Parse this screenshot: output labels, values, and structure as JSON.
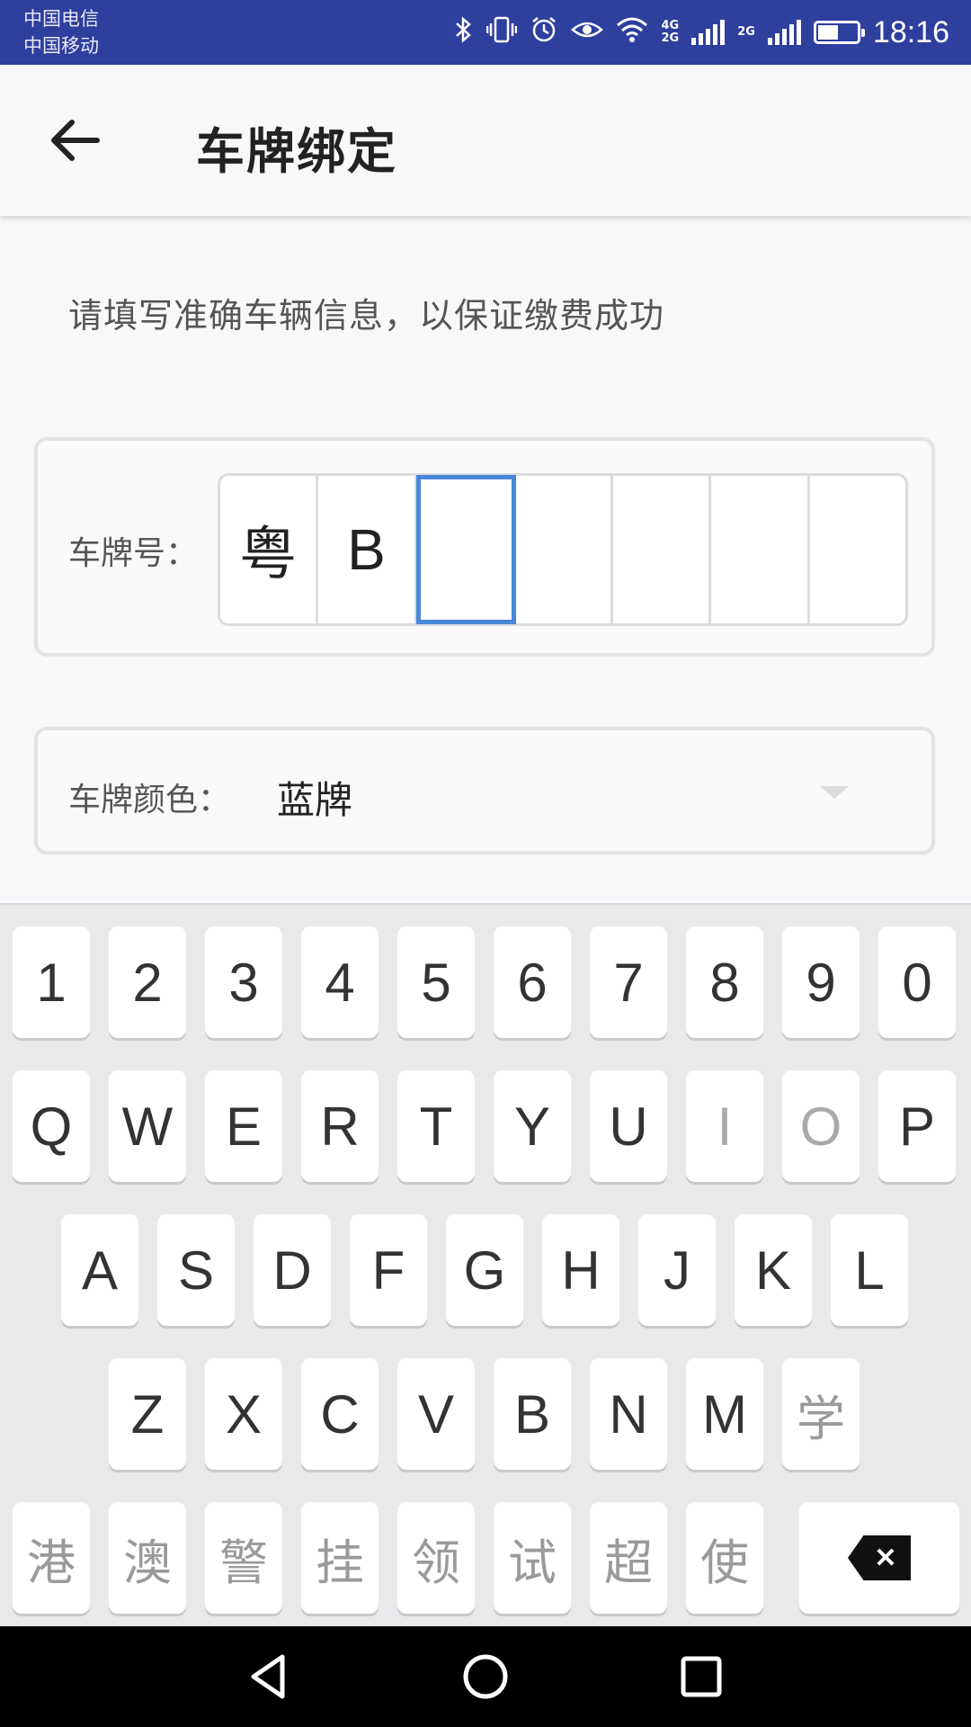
{
  "status": {
    "carrier1": "中国电信",
    "carrier2": "中国移动",
    "net_top": "4G",
    "net_bottom": "2G",
    "net2": "2G",
    "time": "18:16",
    "icons": [
      "bluetooth-icon",
      "vibrate-icon",
      "alarm-icon",
      "eye-icon",
      "wifi-icon",
      "signal-icon",
      "signal-icon",
      "battery-icon"
    ]
  },
  "header": {
    "title": "车牌绑定"
  },
  "hint": "请填写准确车辆信息，以保证缴费成功",
  "plate": {
    "label": "车牌号：",
    "cells": [
      "粤",
      "B",
      "",
      "",
      "",
      "",
      ""
    ],
    "active_index": 2
  },
  "plate_color": {
    "label": "车牌颜色：",
    "value": "蓝牌"
  },
  "keyboard": {
    "row1": [
      "1",
      "2",
      "3",
      "4",
      "5",
      "6",
      "7",
      "8",
      "9",
      "0"
    ],
    "row2": [
      "Q",
      "W",
      "E",
      "R",
      "T",
      "Y",
      "U",
      "I",
      "O",
      "P"
    ],
    "row3": [
      "A",
      "S",
      "D",
      "F",
      "G",
      "H",
      "J",
      "K",
      "L"
    ],
    "row4": [
      "Z",
      "X",
      "C",
      "V",
      "B",
      "N",
      "M",
      "学"
    ],
    "row5": [
      "港",
      "澳",
      "警",
      "挂",
      "领",
      "试",
      "超",
      "使"
    ],
    "disabled": [
      "I",
      "O",
      "学"
    ],
    "delete_symbol": "✕",
    "colors": {
      "active_border": "#4a86d8",
      "status_bar": "#2e3f9e"
    }
  }
}
